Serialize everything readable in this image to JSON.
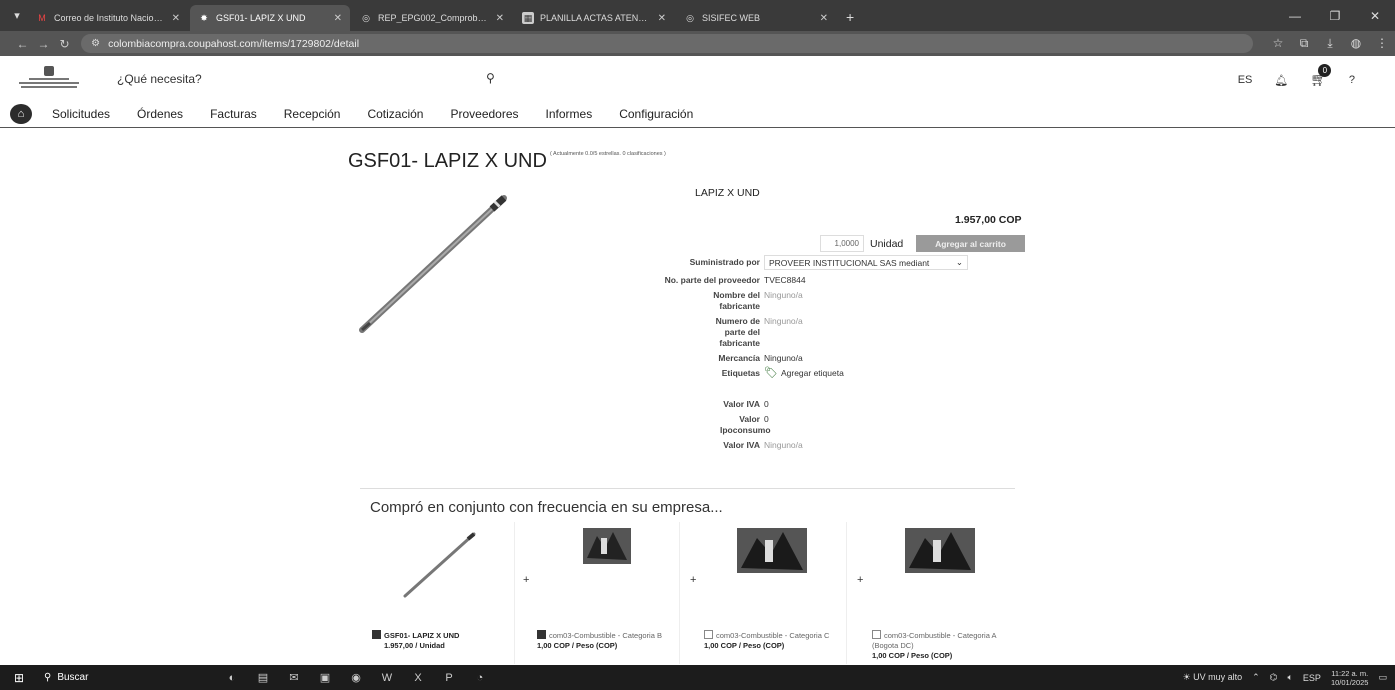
{
  "browser": {
    "tabs": [
      {
        "label": "Correo de Instituto Nacional Pe",
        "icon": "gmail-icon",
        "active": false
      },
      {
        "label": "GSF01- LAPIZ X UND",
        "icon": "coupa-icon",
        "active": true
      },
      {
        "label": "REP_EPG002_ComprobanteCDP",
        "icon": "globe-icon",
        "active": false
      },
      {
        "label": "PLANILLA ACTAS ATENCION Y",
        "icon": "sheet-icon",
        "active": false
      },
      {
        "label": "SISIFEC WEB",
        "icon": "globe-icon",
        "active": false
      }
    ],
    "url": "colombiacompra.coupahost.com/items/1729802/detail"
  },
  "header": {
    "search_placeholder": "¿Qué necesita?",
    "lang": "ES",
    "cart_count": "0",
    "help": "?"
  },
  "menu": [
    "Solicitudes",
    "Órdenes",
    "Facturas",
    "Recepción",
    "Cotización",
    "Proveedores",
    "Informes",
    "Configuración"
  ],
  "product": {
    "title": "GSF01- LAPIZ X UND",
    "rating_text": "( Actualmente 0.0/5 estrellas. 0 clasificaciones )",
    "description": "LAPIZ X UND",
    "price": "1.957,00 COP",
    "quantity": "1,0000",
    "unit": "Unidad",
    "add_to_cart": "Agregar al carrito",
    "attributes": {
      "supplied_by_label": "Suministrado por",
      "supplied_by_value": "PROVEER INSTITUCIONAL SAS mediant",
      "supplier_part_label": "No. parte del proveedor",
      "supplier_part_value": "TVEC8844",
      "manufacturer_label": "Nombre del fabricante",
      "manufacturer_value": "Ninguno/a",
      "manufacturer_part_label": "Numero de parte del fabricante",
      "manufacturer_part_value": "Ninguno/a",
      "commodity_label": "Mercancía",
      "commodity_value": "Ninguno/a",
      "tags_label": "Etiquetas",
      "tags_action": "Agregar etiqueta",
      "iva_label": "Valor IVA",
      "iva_value": "0",
      "ipoconsumo_label": "Valor Ipoconsumo",
      "ipoconsumo_value": "0",
      "iva2_label": "Valor IVA",
      "iva2_value": "Ninguno/a"
    }
  },
  "frequent": {
    "heading": "Compró en conjunto con frecuencia en su empresa...",
    "items": [
      {
        "name": "GSF01- LAPIZ X UND",
        "price": "1.957,00 / Unidad",
        "checked": true
      },
      {
        "name": "com03-Combustible - Categoria B",
        "price": "1,00 COP / Peso (COP)",
        "checked": true
      },
      {
        "name": "com03-Combustible - Categoria C",
        "price": "1,00 COP / Peso (COP)",
        "checked": false
      },
      {
        "name": "com03-Combustible - Categoria A (Bogota DC)",
        "price": "1,00 COP / Peso (COP)",
        "checked": false
      }
    ]
  },
  "taskbar": {
    "search": "Buscar",
    "weather": "UV muy alto",
    "lang": "ESP",
    "time": "11:22 a. m.",
    "date": "10/01/2025"
  }
}
